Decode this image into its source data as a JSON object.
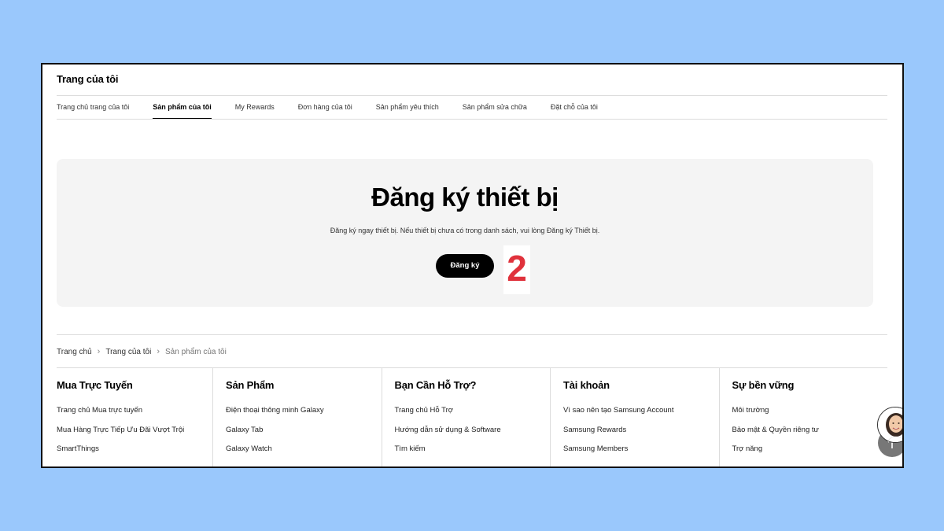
{
  "page": {
    "title": "Trang của tôi"
  },
  "tabs": [
    {
      "label": "Trang chủ trang của tôi",
      "active": false
    },
    {
      "label": "Sản phẩm của tôi",
      "active": true
    },
    {
      "label": "My Rewards",
      "active": false
    },
    {
      "label": "Đơn hàng của tôi",
      "active": false
    },
    {
      "label": "Sản phẩm yêu thích",
      "active": false
    },
    {
      "label": "Sản phẩm sửa chữa",
      "active": false
    },
    {
      "label": "Đặt chỗ của tôi",
      "active": false
    }
  ],
  "register": {
    "title": "Đăng ký thiết bị",
    "description": "Đăng ký ngay thiết bị. Nếu thiết bị chưa có trong danh sách, vui lòng Đăng ký Thiết bị.",
    "button_label": "Đăng ký",
    "step_number": "2"
  },
  "breadcrumb": {
    "items": [
      "Trang chủ",
      "Trang của tôi"
    ],
    "current": "Sản phẩm của tôi"
  },
  "footer": {
    "columns": [
      {
        "heading": "Mua Trực Tuyến",
        "links": [
          "Trang chủ Mua trực tuyến",
          "Mua Hàng Trực Tiếp Ưu Đãi Vượt Trội",
          "SmartThings"
        ]
      },
      {
        "heading": "Sản Phẩm",
        "links": [
          "Điện thoại thông minh Galaxy",
          "Galaxy Tab",
          "Galaxy Watch"
        ]
      },
      {
        "heading": "Bạn Cần Hỗ Trợ?",
        "links": [
          "Trang chủ Hỗ Trợ",
          "Hướng dẫn sử dụng & Software",
          "Tìm kiếm"
        ]
      },
      {
        "heading": "Tài khoản",
        "links": [
          "Vì sao nên tạo Samsung Account",
          "Samsung Rewards",
          "Samsung Members"
        ]
      },
      {
        "heading": "Sự bền vững",
        "links": [
          "Môi trường",
          "Bảo mật & Quyền riêng tư",
          "Trợ năng"
        ]
      }
    ]
  },
  "colors": {
    "background": "#9ac8fc",
    "step_number": "#e0323c",
    "button": "#000000",
    "card": "#f4f4f4"
  },
  "icons": {
    "breadcrumb_separator": "chevron-right-icon",
    "chat": "chat-agent-avatar-icon",
    "scroll_top": "arrow-up-icon"
  }
}
